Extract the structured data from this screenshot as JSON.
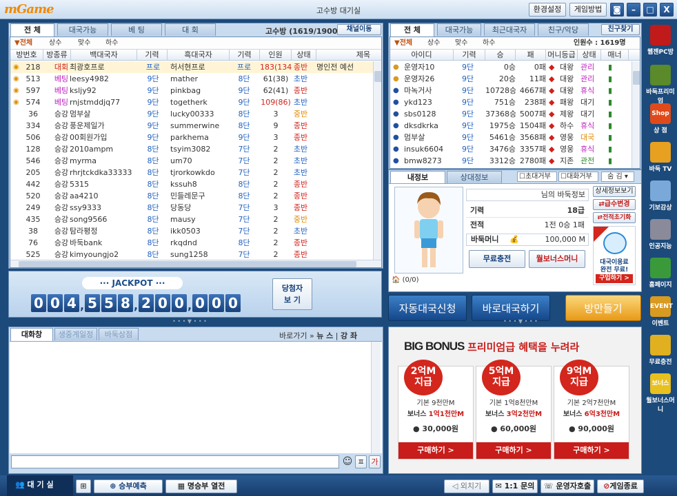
{
  "app": {
    "logo": "mGame",
    "title": "고수방 대기실",
    "buttons": {
      "settings": "환경설정",
      "howto": "게임방법"
    }
  },
  "left": {
    "tabs": [
      "전  체",
      "대국가능",
      "베  팅",
      "대  회"
    ],
    "room_name": "고수방",
    "room_count": "(1619/1900)",
    "channel_move": "채널이동",
    "filters": [
      "▼전체",
      "상수",
      "맞수",
      "하수"
    ],
    "columns": [
      "방번호",
      "방종류",
      "백대국자",
      "기력",
      "흑대국자",
      "기력",
      "인원",
      "상태",
      "제목"
    ],
    "rooms": [
      {
        "no": "218",
        "type": "대회",
        "white": "최광호프로",
        "wl": "프로",
        "black": "허서현프로",
        "bl": "프로",
        "people": "183(134)",
        "state": "종반",
        "title": "명인전 예선",
        "icon": true,
        "sel": true,
        "tc": "c-red",
        "wc": "c-blu",
        "bc": "c-blu",
        "pc": "c-red"
      },
      {
        "no": "513",
        "type": "베팅",
        "white": "leesy4982",
        "wl": "9단",
        "black": "mather",
        "bl": "8단",
        "people": "61(38)",
        "state": "초반",
        "title": "",
        "icon": true,
        "tc": "c-mag"
      },
      {
        "no": "597",
        "type": "베팅",
        "white": "ksljy92",
        "wl": "9단",
        "black": "pinkbag",
        "bl": "9단",
        "people": "62(41)",
        "state": "종반",
        "title": "",
        "icon": true,
        "tc": "c-mag"
      },
      {
        "no": "574",
        "type": "베팅",
        "white": "rnjstmddjq77",
        "wl": "9단",
        "black": "togetherk",
        "bl": "9단",
        "people": "109(86)",
        "state": "초반",
        "title": "",
        "icon": true,
        "tc": "c-mag",
        "pc": "c-red"
      },
      {
        "no": "36",
        "type": "승강",
        "white": "멈부살",
        "wl": "9단",
        "black": "lucky00333",
        "bl": "8단",
        "people": "3",
        "state": "중반",
        "title": ""
      },
      {
        "no": "334",
        "type": "승강",
        "white": "풍운제일가",
        "wl": "9단",
        "black": "summerwine",
        "bl": "8단",
        "people": "9",
        "state": "종반",
        "title": ""
      },
      {
        "no": "506",
        "type": "승강",
        "white": "00회원가입",
        "wl": "9단",
        "black": "parkhema",
        "bl": "9단",
        "people": "3",
        "state": "종반",
        "title": ""
      },
      {
        "no": "128",
        "type": "승강",
        "white": "2010ampm",
        "wl": "8단",
        "black": "tsyim3082",
        "bl": "7단",
        "people": "2",
        "state": "초반",
        "title": ""
      },
      {
        "no": "546",
        "type": "승강",
        "white": "myrma",
        "wl": "8단",
        "black": "um70",
        "bl": "7단",
        "people": "2",
        "state": "초반",
        "title": ""
      },
      {
        "no": "205",
        "type": "승강",
        "white": "rhrjtckdka33333",
        "wl": "8단",
        "black": "tjrorkowkdo",
        "bl": "7단",
        "people": "2",
        "state": "초반",
        "title": ""
      },
      {
        "no": "442",
        "type": "승강",
        "white": "5315",
        "wl": "8단",
        "black": "kssuh8",
        "bl": "8단",
        "people": "2",
        "state": "종반",
        "title": ""
      },
      {
        "no": "520",
        "type": "승강",
        "white": "aa4210",
        "wl": "8단",
        "black": "민들레문구",
        "bl": "8단",
        "people": "2",
        "state": "종반",
        "title": ""
      },
      {
        "no": "249",
        "type": "승강",
        "white": "ssy9333",
        "wl": "8단",
        "black": "당동당",
        "bl": "7단",
        "people": "3",
        "state": "종반",
        "title": ""
      },
      {
        "no": "435",
        "type": "승강",
        "white": "song9566",
        "wl": "8단",
        "black": "mausy",
        "bl": "7단",
        "people": "2",
        "state": "중반",
        "title": ""
      },
      {
        "no": "38",
        "type": "승강",
        "white": "탐라평정",
        "wl": "8단",
        "black": "ikk0503",
        "bl": "7단",
        "people": "2",
        "state": "초반",
        "title": ""
      },
      {
        "no": "76",
        "type": "승강",
        "white": "바둑bank",
        "wl": "8단",
        "black": "rkqdnd",
        "bl": "8단",
        "people": "2",
        "state": "종반",
        "title": ""
      },
      {
        "no": "525",
        "type": "승강",
        "white": "kimyoungjo2",
        "wl": "8단",
        "black": "sung1258",
        "bl": "7단",
        "people": "2",
        "state": "종반",
        "title": ""
      }
    ],
    "jackpot": {
      "label": "··· JACKPOT ···",
      "digits": [
        "0",
        "0",
        "4",
        "5",
        "5",
        "8",
        "2",
        "0",
        "0",
        "0",
        "0",
        "0"
      ],
      "winners": "당첨자\n보 기"
    }
  },
  "right": {
    "tabs": [
      "전  체",
      "대국가능",
      "최근대국자",
      "친구/악당"
    ],
    "find_friend": "친구찾기",
    "filters": [
      "▼전체",
      "상수",
      "맞수",
      "하수"
    ],
    "online": "인원수 : 1619명",
    "columns": [
      "아이디",
      "기력",
      "승",
      "패",
      "머니등급",
      "상태",
      "매너"
    ],
    "users": [
      {
        "id": "운영자10",
        "lv": "9단",
        "w": "0승",
        "l": "0패",
        "rank": "대왕",
        "st": "관리",
        "stc": "c-mag"
      },
      {
        "id": "운영자26",
        "lv": "9단",
        "w": "20승",
        "l": "11패",
        "rank": "대왕",
        "st": "관리",
        "stc": "c-mag"
      },
      {
        "id": "마녹거사",
        "lv": "9단",
        "w": "10728승",
        "l": "4667패",
        "rank": "대왕",
        "st": "휴식",
        "stc": "c-mag"
      },
      {
        "id": "ykd123",
        "lv": "9단",
        "w": "751승",
        "l": "238패",
        "rank": "패왕",
        "st": "대기",
        "stc": ""
      },
      {
        "id": "sbs0128",
        "lv": "9단",
        "w": "37368승",
        "l": "5007패",
        "rank": "제왕",
        "st": "대기",
        "stc": ""
      },
      {
        "id": "dksdkrka",
        "lv": "9단",
        "w": "1975승",
        "l": "1504패",
        "rank": "하수",
        "st": "휴식",
        "stc": "c-mag"
      },
      {
        "id": "멈부살",
        "lv": "9단",
        "w": "5461승",
        "l": "3568패",
        "rank": "영웅",
        "st": "대국",
        "stc": "c-org"
      },
      {
        "id": "insuk6604",
        "lv": "9단",
        "w": "3476승",
        "l": "3357패",
        "rank": "영웅",
        "st": "휴식",
        "stc": "c-mag"
      },
      {
        "id": "bmw8273",
        "lv": "9단",
        "w": "3312승",
        "l": "2780패",
        "rank": "지존",
        "st": "관전",
        "stc": "c-grn"
      }
    ],
    "subtabs": [
      "내정보",
      "상대정보"
    ],
    "inv_refuse": "초대거부",
    "chat_refuse": "대화거부",
    "hide": "숨 김",
    "profile": {
      "title": "님의 바둑정보",
      "level_label": "기력",
      "level": "18급",
      "record_label": "전적",
      "record": "1전 0승 1패",
      "money_label": "바둑머니",
      "money": "100,000 M",
      "points": "(0/0)"
    },
    "profile_btns": {
      "charge": "무료충전",
      "bonus": "월보너스머니",
      "detail": "상세정보보기",
      "change": "급수변경",
      "reset": "전적초기화",
      "promo1": "대국이용료",
      "promo2": "완전 무료!",
      "promo_buy": "구입하기 >"
    },
    "auto_match": "자동대국신청",
    "quick_match": "바로대국하기",
    "create_room": "방만들기"
  },
  "chat": {
    "tabs": [
      "대화창",
      "생중계일정",
      "바둑상점"
    ],
    "goto": "바로가기 »",
    "news": "뉴 스",
    "lecture": "강 좌"
  },
  "banner": {
    "title": "BIG BONUS",
    "subtitle": "프리미엄급 혜택을 누려라",
    "offers": [
      {
        "bubble": "2억M\n지급",
        "base": "기본 9천만M",
        "bonus_label": "보너스",
        "bonus": "1억1천만M",
        "price": "30,000원",
        "buy": "구매하기 >"
      },
      {
        "bubble": "5억M\n지급",
        "base": "기본 1억8천만M",
        "bonus_label": "보너스",
        "bonus": "3억2천만M",
        "price": "60,000원",
        "buy": "구매하기 >"
      },
      {
        "bubble": "9억M\n지급",
        "base": "기본 2억7천만M",
        "bonus_label": "보너스",
        "bonus": "6억3천만M",
        "price": "90,000원",
        "buy": "구매하기 >"
      }
    ]
  },
  "sidebar": [
    {
      "label": "웹젠PC방",
      "color": "#c01a1a"
    },
    {
      "label": "바둑프리미엄",
      "color": "#5a8a2a"
    },
    {
      "label": "상 점",
      "color": "#e04a1a",
      "extra": "Shop"
    },
    {
      "label": "바둑 TV",
      "color": "#e8a020"
    },
    {
      "label": "기보감상",
      "color": "#7aa8d8"
    },
    {
      "label": "인공지능",
      "color": "#8a8a9a"
    },
    {
      "label": "홈페이지",
      "color": "#3a9a3a"
    },
    {
      "label": "이벤트",
      "color": "#d89a20",
      "extra": "EVENT"
    },
    {
      "label": "무료충전",
      "color": "#e0b020"
    },
    {
      "label": "월보너스머니",
      "color": "#e8c020",
      "extra": "보너스"
    }
  ],
  "bottom": {
    "lobby": "대 기 실",
    "predict": "승부예측",
    "famous": "명승부 열전",
    "invite": "외치기",
    "inquiry": "1:1 문의",
    "call_admin": "운영자호출",
    "exit": "게임종료"
  }
}
